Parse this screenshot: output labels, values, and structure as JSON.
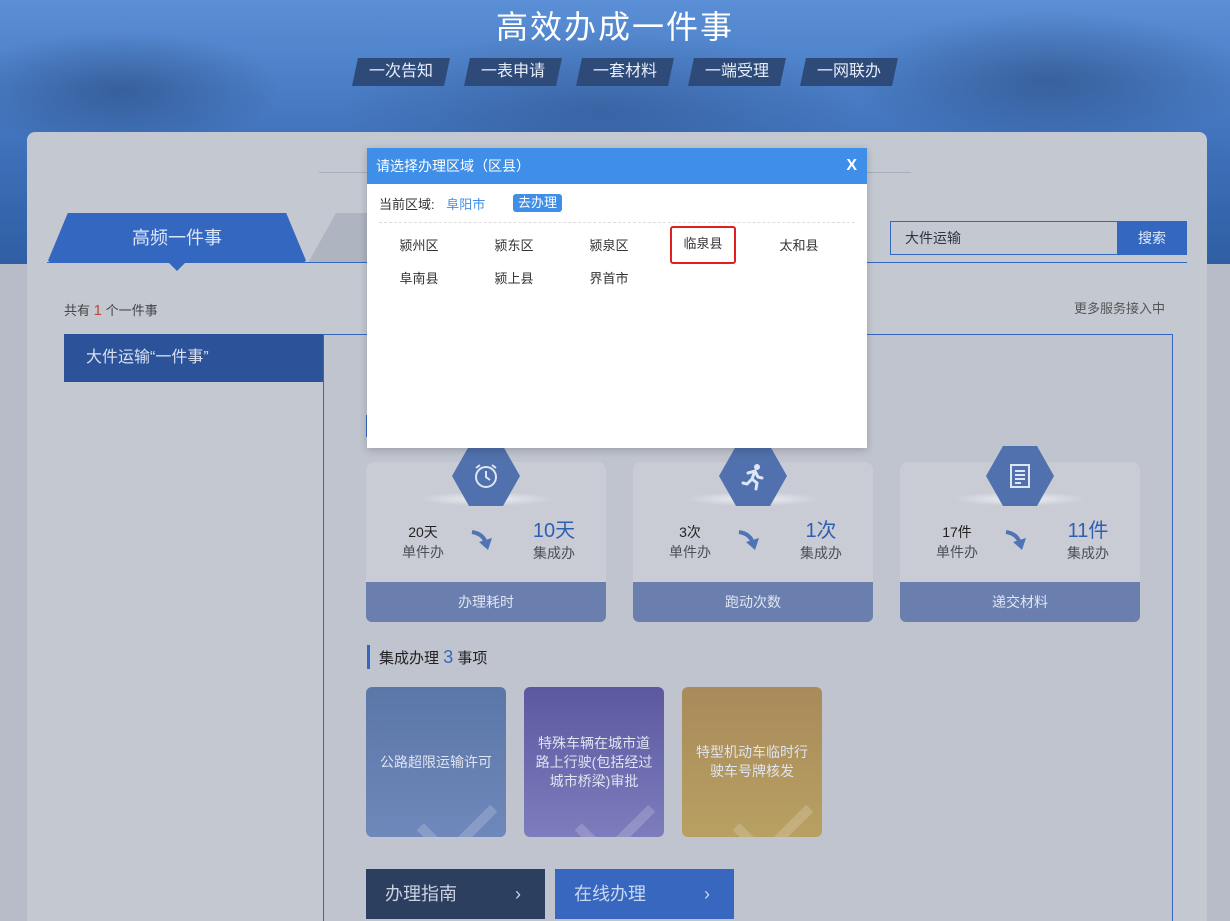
{
  "banner": {
    "title": "高效办成一件事",
    "pills": [
      "一次告知",
      "一表申请",
      "一套材料",
      "一端受理",
      "一网联办"
    ]
  },
  "tabs": {
    "active_label": "高频一件事"
  },
  "search": {
    "value": "大件运输",
    "button": "搜索"
  },
  "summary": {
    "prefix": "共有",
    "count": "1",
    "suffix": "个一件事",
    "more": "更多服务接入中"
  },
  "sidebar": {
    "items": [
      {
        "label": "大件运输“一件事”"
      }
    ]
  },
  "stats": [
    {
      "before_value": "20天",
      "before_label": "单件办",
      "after_value": "10天",
      "after_label": "集成办",
      "footer": "办理耗时",
      "icon": "alarm-clock-icon"
    },
    {
      "before_value": "3次",
      "before_label": "单件办",
      "after_value": "1次",
      "after_label": "集成办",
      "footer": "跑动次数",
      "icon": "running-person-icon"
    },
    {
      "before_value": "17件",
      "before_label": "单件办",
      "after_value": "11件",
      "after_label": "集成办",
      "footer": "递交材料",
      "icon": "document-icon"
    }
  ],
  "integrated": {
    "title_prefix": "集成办理",
    "count": "3",
    "title_suffix": "事项",
    "items": [
      {
        "label": "公路超限运输许可"
      },
      {
        "label": "特殊车辆在城市道路上行驶(包括经过城市桥梁)审批"
      },
      {
        "label": "特型机动车临时行驶车号牌核发"
      }
    ]
  },
  "actions": {
    "guide": "办理指南",
    "online": "在线办理"
  },
  "modal": {
    "title": "请选择办理区域（区县）",
    "close": "X",
    "current_label": "当前区域:",
    "current_city": "阜阳市",
    "go_button": "去办理",
    "districts": [
      "颍州区",
      "颍东区",
      "颍泉区",
      "临泉县",
      "太和县",
      "阜南县",
      "颍上县",
      "界首市"
    ],
    "highlighted": "临泉县"
  },
  "colors": {
    "primary": "#3468c0",
    "modal_header": "#3f8ee8",
    "highlight_border": "#e0201e"
  }
}
